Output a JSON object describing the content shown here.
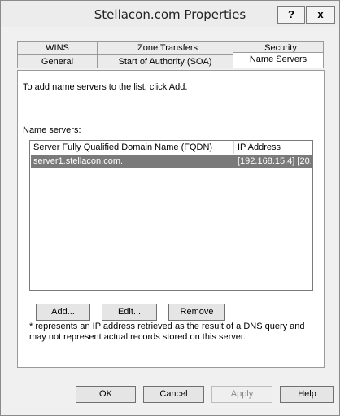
{
  "window": {
    "title": "Stellacon.com Properties",
    "help_label": "?",
    "close_label": "x"
  },
  "tabs": {
    "row1": [
      {
        "label": "WINS"
      },
      {
        "label": "Zone Transfers"
      },
      {
        "label": "Security"
      }
    ],
    "row2": [
      {
        "label": "General"
      },
      {
        "label": "Start of Authority (SOA)"
      },
      {
        "label": "Name Servers",
        "active": true
      }
    ]
  },
  "panel": {
    "instruction": "To add name servers to the list, click Add.",
    "list_label": "Name servers:",
    "columns": [
      "Server Fully Qualified Domain Name (FQDN)",
      "IP Address"
    ],
    "rows": [
      {
        "fqdn": "server1.stellacon.com.",
        "ip": "[192.168.15.4] [20..."
      }
    ],
    "buttons": {
      "add": "Add...",
      "edit": "Edit...",
      "remove": "Remove"
    },
    "note": "* represents an IP address retrieved as the result of a DNS query and may not represent actual records stored on this server."
  },
  "footer": {
    "ok": "OK",
    "cancel": "Cancel",
    "apply": "Apply",
    "help": "Help"
  }
}
